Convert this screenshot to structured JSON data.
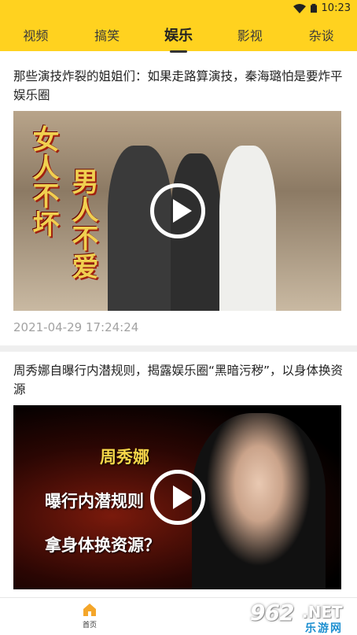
{
  "status_bar": {
    "time": "10:23"
  },
  "tabs": [
    {
      "label": "视频"
    },
    {
      "label": "搞笑"
    },
    {
      "label": "娱乐",
      "active": true
    },
    {
      "label": "影视"
    },
    {
      "label": "杂谈"
    }
  ],
  "articles": [
    {
      "title": "那些演技炸裂的姐姐们：如果走路算演技，秦海璐怕是要炸平娱乐圈",
      "thumb_text": [
        "女人不坏",
        "男人不爱"
      ],
      "timestamp": "2021-04-29 17:24:24"
    },
    {
      "title": "周秀娜自曝行内潜规则，揭露娱乐圈“黑暗污秽”，以身体换资源",
      "thumb_text": [
        "周秀娜",
        "曝行内潜规则",
        "拿身体换资源？"
      ]
    }
  ],
  "bottom_nav": {
    "home_label": "首页"
  },
  "watermark": {
    "brand": "962",
    "net": ".NET",
    "sub": "乐游网"
  },
  "colors": {
    "accent": "#ffd21f",
    "timestamp": "#a2a2a2"
  }
}
